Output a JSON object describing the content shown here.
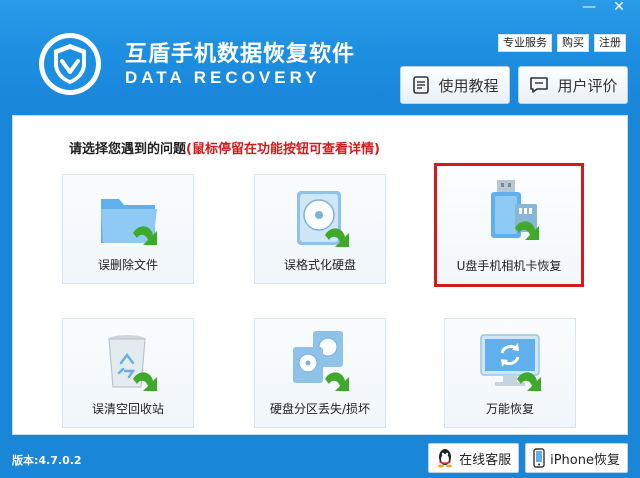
{
  "window": {
    "minimize_glyph": "—",
    "close_glyph": "✕"
  },
  "header": {
    "title_cn": "互盾手机数据恢复软件",
    "title_en": "DATA RECOVERY",
    "links": [
      "专业服务",
      "购买",
      "注册"
    ],
    "tutorial_label": "使用教程",
    "review_label": "用户评价"
  },
  "main": {
    "prompt": "请选择您遇到的问题",
    "hint": "(鼠标停留在功能按钮可查看详情)",
    "tiles": [
      {
        "label": "误删除文件",
        "icon": "folder-icon"
      },
      {
        "label": "误格式化硬盘",
        "icon": "hard-disk-icon"
      },
      {
        "label": "U盘手机相机卡恢复",
        "icon": "usb-card-icon"
      },
      {
        "label": "误清空回收站",
        "icon": "recycle-bin-icon"
      },
      {
        "label": "硬盘分区丢失/损坏",
        "icon": "partition-disk-icon"
      },
      {
        "label": "万能恢复",
        "icon": "monitor-refresh-icon"
      }
    ]
  },
  "footer": {
    "version": "版本:4.7.0.2",
    "online_service": "在线客服",
    "iphone_restore": "iPhone恢复"
  },
  "colors": {
    "accent": "#1a86d8",
    "highlight": "#d21b1b",
    "hint": "#d41a1a",
    "arrow_green": "#3faa2a"
  }
}
